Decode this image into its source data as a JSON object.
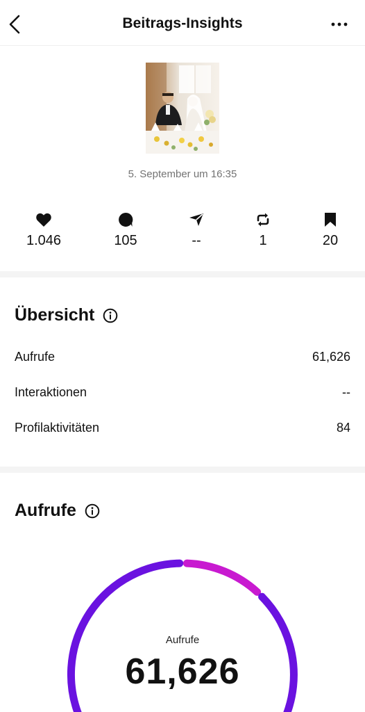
{
  "header": {
    "title": "Beitrags-Insights",
    "back_icon": "chevron-left-icon",
    "more_icon": "more-horizontal-icon"
  },
  "post": {
    "date": "5. September um 16:35"
  },
  "stats": {
    "likes": "1.046",
    "comments": "105",
    "shares": "--",
    "reposts": "1",
    "saves": "20"
  },
  "overview": {
    "title": "Übersicht",
    "rows": [
      {
        "label": "Aufrufe",
        "value": "61,626"
      },
      {
        "label": "Interaktionen",
        "value": "--"
      },
      {
        "label": "Profilaktivitäten",
        "value": "84"
      }
    ]
  },
  "views": {
    "title": "Aufrufe",
    "donut_label": "Aufrufe",
    "donut_value": "61,626",
    "colors": {
      "primary": "#6a12e0",
      "secondary": "#c81ad0"
    }
  }
}
